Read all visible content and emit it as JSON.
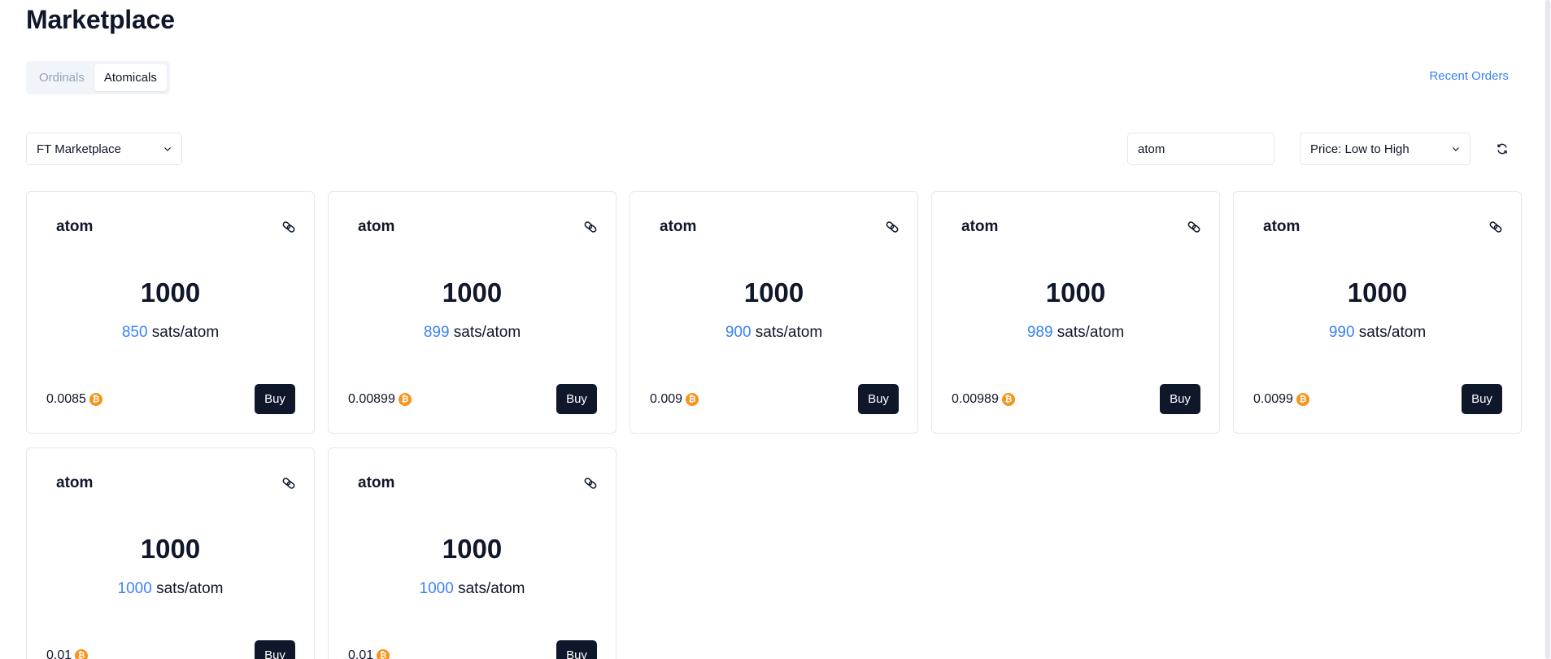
{
  "header": {
    "title": "Marketplace"
  },
  "tabs": [
    {
      "label": "Ordinals",
      "active": false
    },
    {
      "label": "Atomicals",
      "active": true
    }
  ],
  "recent_orders_label": "Recent Orders",
  "filters": {
    "market_select": "FT Marketplace",
    "search_value": "atom",
    "sort_select": "Price: Low to High"
  },
  "icons": {
    "chevron": "chevron-down-icon",
    "refresh": "refresh-icon",
    "link": "link-icon",
    "bitcoin": "bitcoin-icon"
  },
  "colors": {
    "accent": "#3b82f6",
    "button_dark": "#0f172a",
    "bitcoin": "#f7931a"
  },
  "buy_label": "Buy",
  "unit_label": "sats/atom",
  "btc_symbol": "₿",
  "cards": [
    {
      "ticker": "atom",
      "amount": "1000",
      "price": "850",
      "total": "0.0085"
    },
    {
      "ticker": "atom",
      "amount": "1000",
      "price": "899",
      "total": "0.00899"
    },
    {
      "ticker": "atom",
      "amount": "1000",
      "price": "900",
      "total": "0.009"
    },
    {
      "ticker": "atom",
      "amount": "1000",
      "price": "989",
      "total": "0.00989"
    },
    {
      "ticker": "atom",
      "amount": "1000",
      "price": "990",
      "total": "0.0099"
    },
    {
      "ticker": "atom",
      "amount": "1000",
      "price": "1000",
      "total": "0.01"
    },
    {
      "ticker": "atom",
      "amount": "1000",
      "price": "1000",
      "total": "0.01"
    }
  ]
}
